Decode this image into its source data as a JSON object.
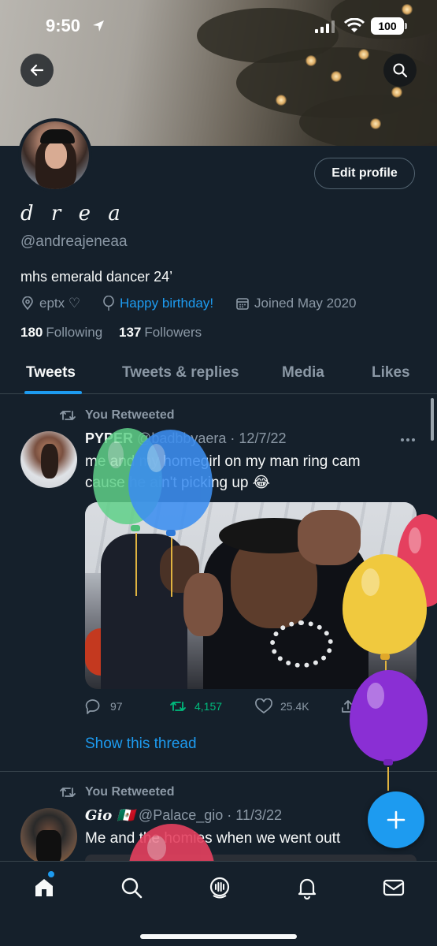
{
  "status_bar": {
    "time": "9:50",
    "battery": "100"
  },
  "profile": {
    "display_name": "d r e a",
    "handle": "@andreajeneaa",
    "bio": "mhs emerald dancer 24’",
    "location": "eptx ♡",
    "birthday": "Happy birthday!",
    "joined": "Joined May 2020",
    "following_count": "180",
    "following_label": "Following",
    "followers_count": "137",
    "followers_label": "Followers",
    "edit_profile_label": "Edit profile"
  },
  "tabs": [
    {
      "label": "Tweets",
      "active": true
    },
    {
      "label": "Tweets & replies",
      "active": false
    },
    {
      "label": "Media",
      "active": false
    },
    {
      "label": "Likes",
      "active": false
    }
  ],
  "tweets": [
    {
      "retweet_label": "You Retweeted",
      "name": "PYPER",
      "handle": "@badbbyaera",
      "date": "· 12/7/22",
      "text_line1": "me and my homegirl on my man ring cam",
      "text_line2": "cause he ain't picking up 😂",
      "replies": "97",
      "retweets": "4,157",
      "likes": "25.4K",
      "show_thread": "Show this thread"
    },
    {
      "retweet_label": "You Retweeted",
      "name": "Gio 🇲🇽",
      "handle": "@Palace_gio",
      "date": "· 11/3/22",
      "text_line1": "Me and the homies when we went outt"
    }
  ],
  "colors": {
    "background": "#15202b",
    "accent": "#1d9bf0",
    "retweet_green": "#00ba7c",
    "muted": "#8b98a5"
  },
  "icons": [
    "back-arrow-icon",
    "search-icon",
    "location-icon",
    "balloon-icon",
    "calendar-icon",
    "retweet-icon",
    "more-icon",
    "reply-icon",
    "like-icon",
    "share-icon",
    "compose-icon",
    "home-icon",
    "spaces-icon",
    "bell-icon",
    "mail-icon"
  ]
}
